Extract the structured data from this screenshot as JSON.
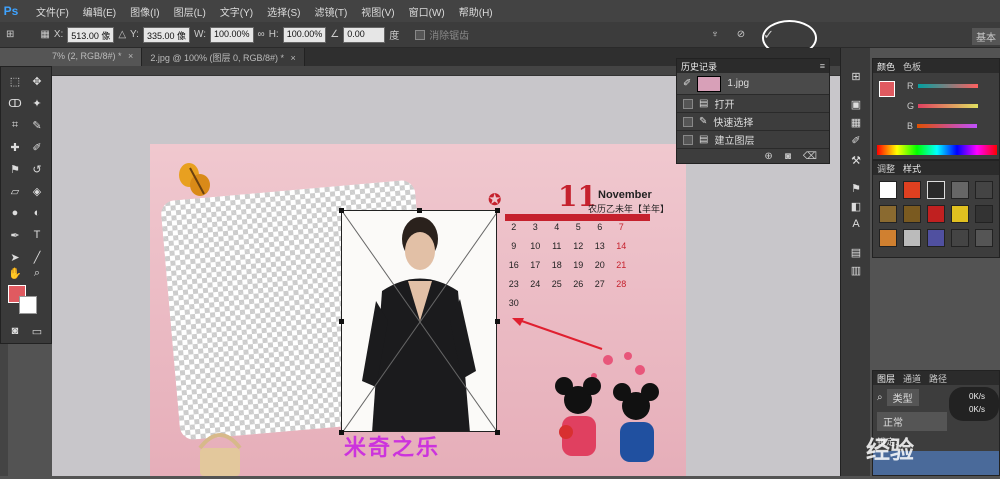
{
  "app": {
    "logo": "Ps"
  },
  "menu": [
    "文件(F)",
    "编辑(E)",
    "图像(I)",
    "图层(L)",
    "文字(Y)",
    "选择(S)",
    "滤镜(T)",
    "视图(V)",
    "窗口(W)",
    "帮助(H)"
  ],
  "options": {
    "x_label": "X:",
    "x_value": "513.00 像",
    "y_label": "Y:",
    "y_value": "335.00 像",
    "w_label": "W:",
    "w_value": "100.00%",
    "h_label": "H:",
    "h_value": "100.00%",
    "angle_value": "0.00",
    "angle_unit": "度",
    "antialias_label": "消除锯齿",
    "workspace": "基本"
  },
  "tabs": [
    {
      "label": "7% (2, RGB/8#) *",
      "active": true
    },
    {
      "label": "2.jpg @ 100% (图层 0, RGB/8#) *",
      "active": false
    }
  ],
  "history": {
    "title": "历史记录",
    "snapshot": "1.jpg",
    "items": [
      "打开",
      "快速选择",
      "建立图层"
    ]
  },
  "color_panel": {
    "tabs": [
      "颜色",
      "色板"
    ],
    "channels": [
      "R",
      "G",
      "B"
    ]
  },
  "style_panel": {
    "tabs": [
      "调整",
      "样式"
    ]
  },
  "layers_panel": {
    "tabs": [
      "图层",
      "通道",
      "路径"
    ],
    "filter": "类型",
    "blend": "正常",
    "lock": "锁定:",
    "rates": [
      "0K/s",
      "0K/s"
    ]
  },
  "calendar": {
    "day": "11",
    "month": "November",
    "lunar": "农历乙未年【羊年】",
    "rows": [
      [
        "2",
        "3",
        "4",
        "5",
        "6",
        "7"
      ],
      [
        "9",
        "10",
        "11",
        "12",
        "13",
        "14"
      ],
      [
        "16",
        "17",
        "18",
        "19",
        "20",
        "21"
      ],
      [
        "23",
        "24",
        "25",
        "26",
        "27",
        "28"
      ],
      [
        "30",
        "",
        "",
        "",
        "",
        ""
      ]
    ]
  },
  "artwork": {
    "footer": "米奇之乐"
  },
  "watermark": "经验"
}
